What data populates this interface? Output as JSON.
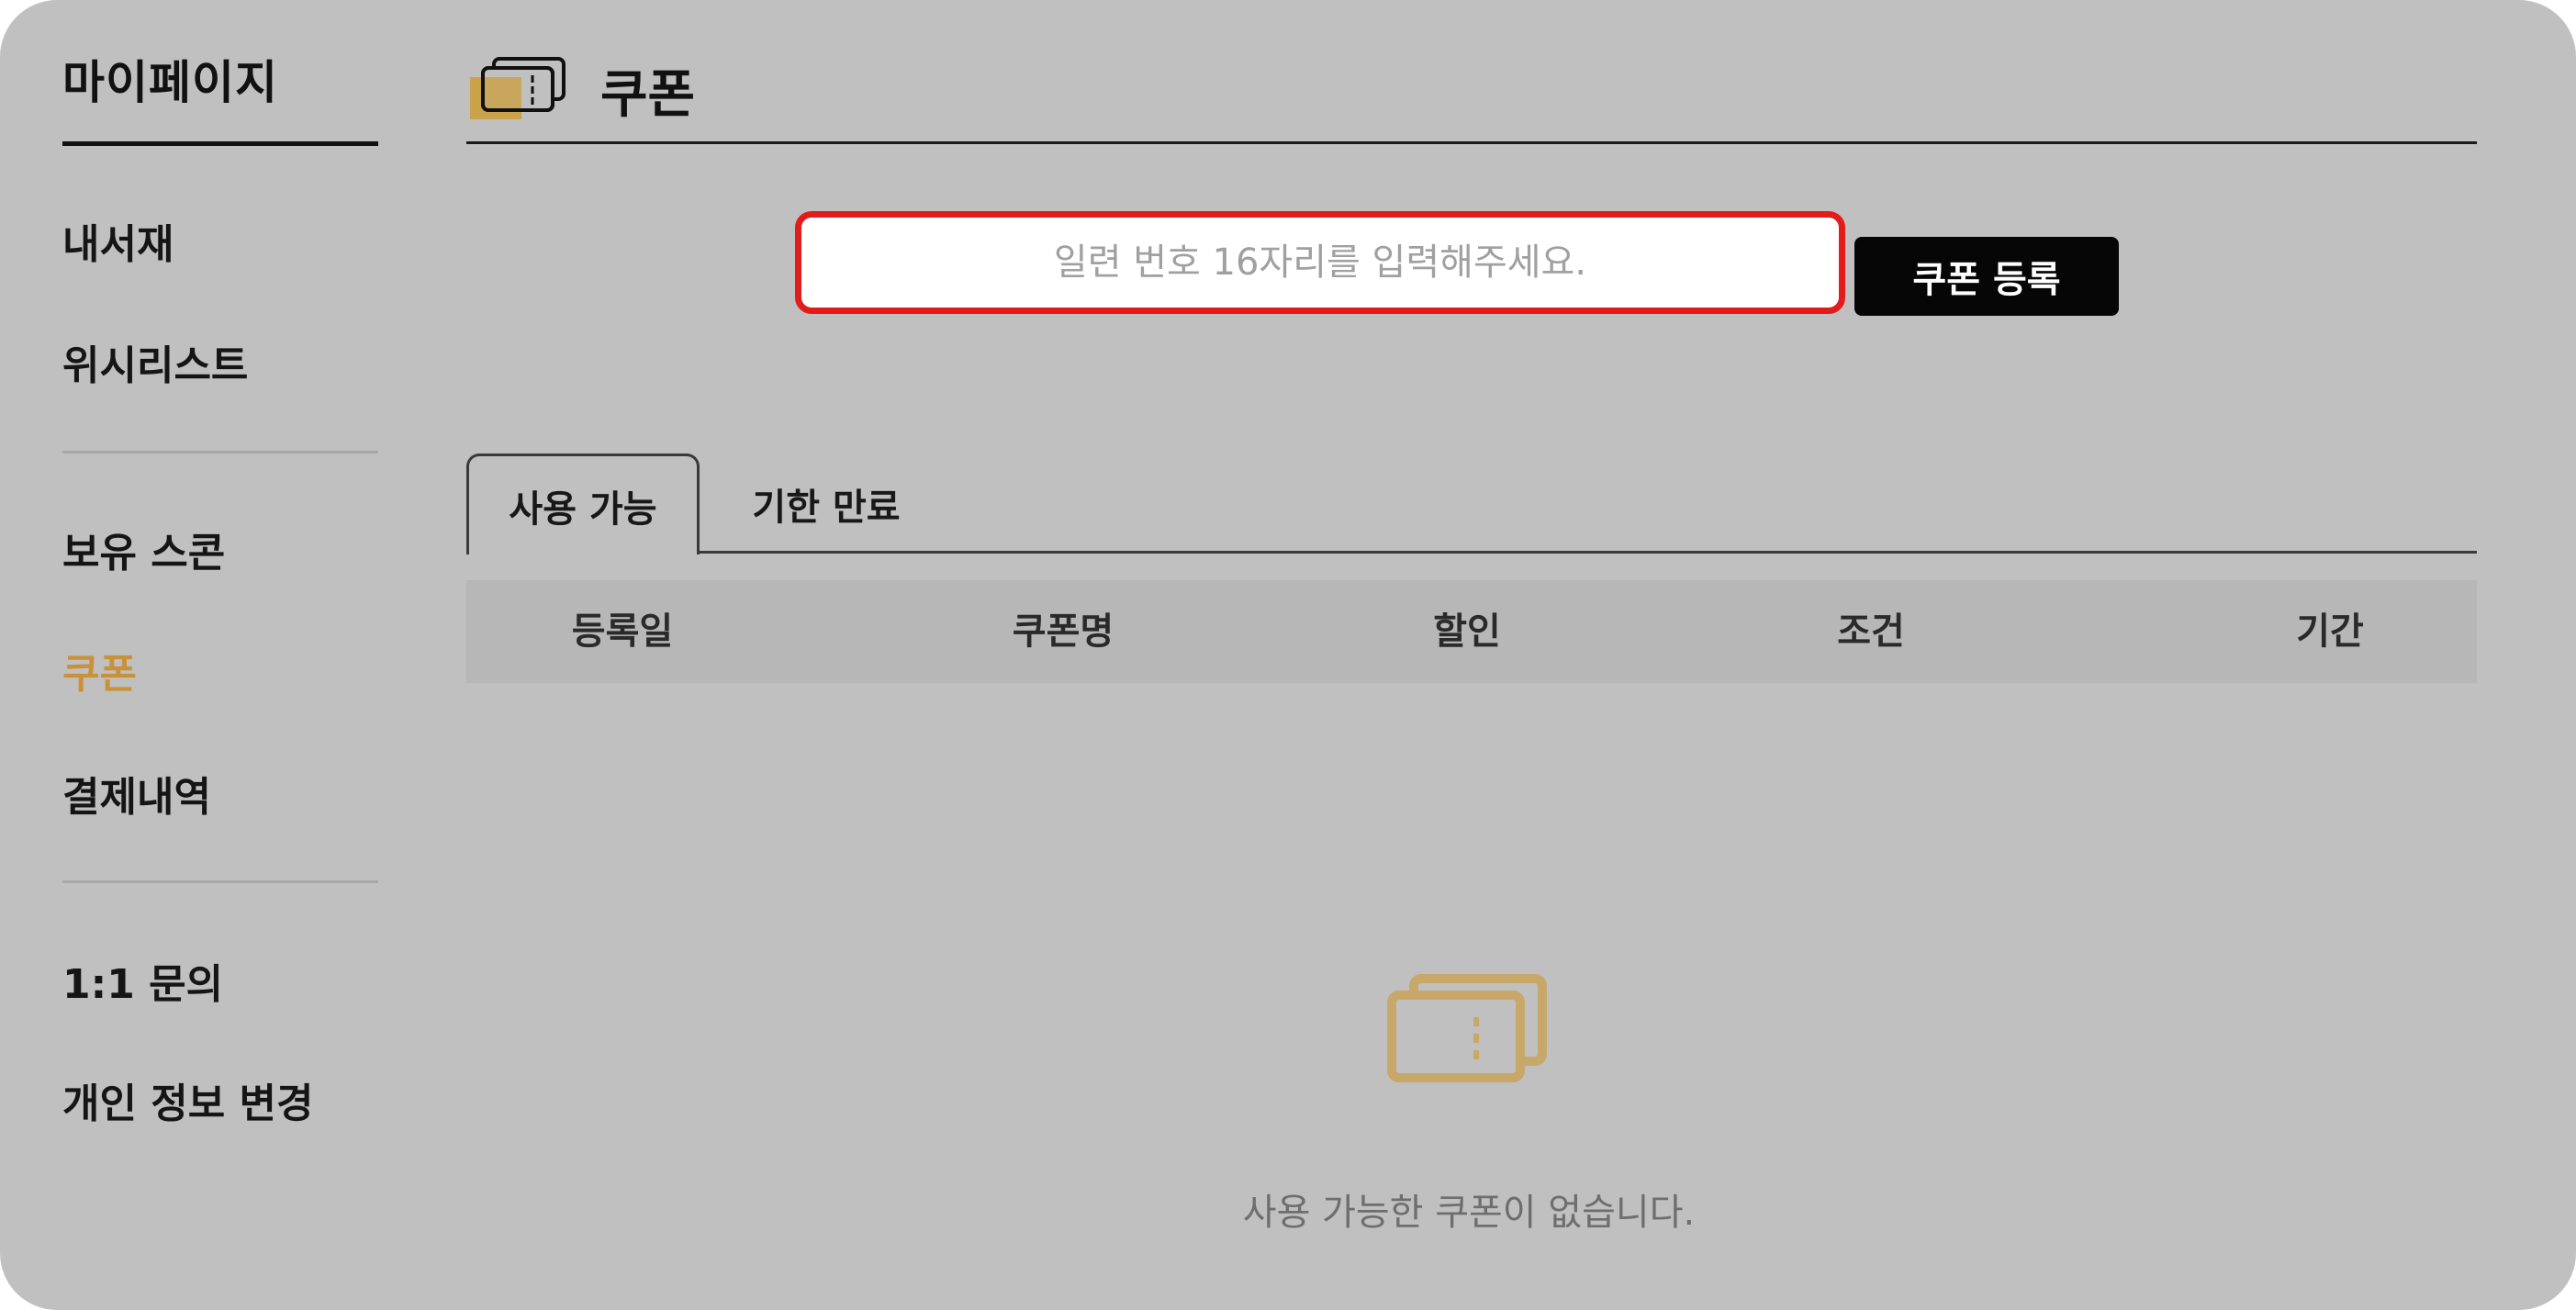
{
  "sidebar": {
    "title": "마이페이지",
    "groups": [
      {
        "items": [
          {
            "label": "내서재"
          },
          {
            "label": "위시리스트"
          }
        ]
      },
      {
        "items": [
          {
            "label": "보유 스콘"
          },
          {
            "label": "쿠폰",
            "active": true
          },
          {
            "label": "결제내역"
          }
        ]
      },
      {
        "items": [
          {
            "label": "1:1 문의"
          },
          {
            "label": "개인 정보 변경"
          }
        ]
      }
    ]
  },
  "header": {
    "title": "쿠폰",
    "icon": "coupon-ticket-icon"
  },
  "register": {
    "placeholder": "일련 번호 16자리를 입력해주세요.",
    "value": "",
    "button_label": "쿠폰 등록"
  },
  "tabs": [
    {
      "label": "사용 가능",
      "active": true
    },
    {
      "label": "기한 만료",
      "active": false
    }
  ],
  "table": {
    "columns": [
      "등록일",
      "쿠폰명",
      "할인",
      "조건",
      "기간"
    ]
  },
  "empty_state": {
    "icon": "coupon-empty-icon",
    "message": "사용 가능한 쿠폰이 없습니다."
  },
  "colors": {
    "accent": "#c9923a",
    "input_border": "#e21b1b",
    "button_bg": "#060606",
    "background": "#c0c0c0"
  }
}
